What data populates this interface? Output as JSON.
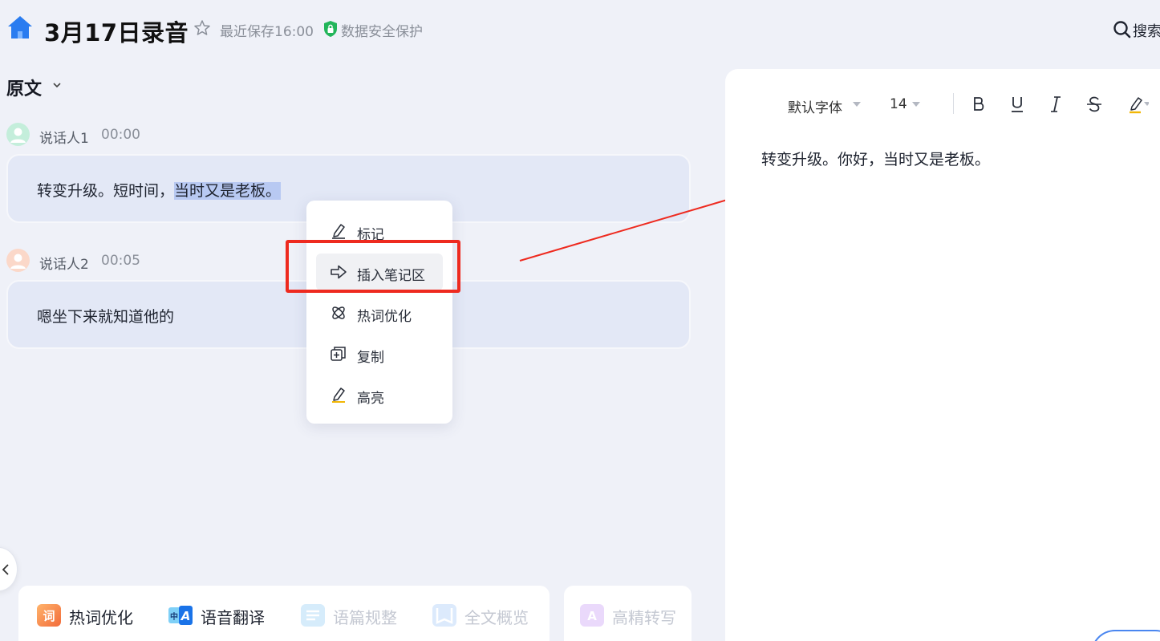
{
  "header": {
    "title": "3月17日录音",
    "save_status": "最近保存16:00",
    "security_label": "数据安全保护",
    "search_label": "搜索"
  },
  "transcript": {
    "section_title": "原文",
    "segments": [
      {
        "speaker": "说话人1",
        "time": "00:00",
        "text_before": "转变升级。短时间，",
        "text_selected": "当时又是老板。"
      },
      {
        "speaker": "说话人2",
        "time": "00:05",
        "text": "嗯坐下来就知道他的"
      }
    ]
  },
  "context_menu": {
    "items": [
      {
        "label": "标记",
        "icon": "pen-mark-icon"
      },
      {
        "label": "插入笔记区",
        "icon": "arrow-right-icon",
        "active": true
      },
      {
        "label": "热词优化",
        "icon": "atom-icon"
      },
      {
        "label": "复制",
        "icon": "copy-icon"
      },
      {
        "label": "高亮",
        "icon": "highlighter-icon"
      }
    ]
  },
  "bottom_tools": [
    {
      "label": "热词优化",
      "icon": "hotword-icon",
      "enabled": true
    },
    {
      "label": "语音翻译",
      "icon": "translate-icon",
      "enabled": true
    },
    {
      "label": "语篇规整",
      "icon": "format-icon",
      "enabled": false
    },
    {
      "label": "全文概览",
      "icon": "overview-icon",
      "enabled": false
    },
    {
      "label": "高精转写",
      "icon": "hq-transcribe-icon",
      "enabled": false
    }
  ],
  "editor": {
    "font": "默认字体",
    "size": "14",
    "content": "转变升级。你好，当时又是老板。"
  },
  "colors": {
    "accent_red": "#ee2a1f",
    "brand_blue": "#2a7cf0",
    "highlight": "#b8c9f2"
  }
}
